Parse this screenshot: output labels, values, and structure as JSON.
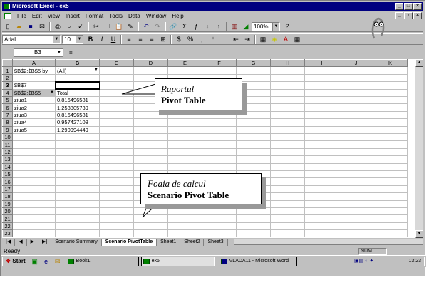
{
  "window": {
    "title": "Microsoft Excel - ex5",
    "minimize_icon": "minimize-icon",
    "maximize_icon": "maximize-icon",
    "close_icon": "close-icon"
  },
  "menubar": {
    "items": [
      "File",
      "Edit",
      "View",
      "Insert",
      "Format",
      "Tools",
      "Data",
      "Window",
      "Help"
    ]
  },
  "toolbar1": {
    "zoom": "100%"
  },
  "toolbar2": {
    "font_name": "Arial",
    "font_size": "10",
    "bold": "B",
    "italic": "I",
    "underline": "U",
    "percent": "%",
    "comma": ","
  },
  "formula_bar": {
    "name_box": "B3",
    "equals": "="
  },
  "grid": {
    "columns": [
      "A",
      "B",
      "C",
      "D",
      "E",
      "F",
      "G",
      "H",
      "I",
      "J",
      "K"
    ],
    "rows": [
      {
        "n": "1",
        "a": "$B$2:$B$5 by",
        "b": "(All)"
      },
      {
        "n": "2",
        "a": "",
        "b": ""
      },
      {
        "n": "3",
        "a": "$B$7",
        "b": ""
      },
      {
        "n": "4",
        "a": "$B$2:$B$5",
        "b": "Total"
      },
      {
        "n": "5",
        "a": "ziua1",
        "b": "0,816496581"
      },
      {
        "n": "6",
        "a": "ziua2",
        "b": "1,258305739"
      },
      {
        "n": "7",
        "a": "ziua3",
        "b": "0,816496581"
      },
      {
        "n": "8",
        "a": "ziua4",
        "b": "0,957427108"
      },
      {
        "n": "9",
        "a": "ziua5",
        "b": "1,290994449"
      },
      {
        "n": "10",
        "a": "",
        "b": ""
      },
      {
        "n": "11",
        "a": "",
        "b": ""
      },
      {
        "n": "12",
        "a": "",
        "b": ""
      },
      {
        "n": "13",
        "a": "",
        "b": ""
      },
      {
        "n": "14",
        "a": "",
        "b": ""
      },
      {
        "n": "15",
        "a": "",
        "b": ""
      },
      {
        "n": "16",
        "a": "",
        "b": ""
      },
      {
        "n": "17",
        "a": "",
        "b": ""
      },
      {
        "n": "18",
        "a": "",
        "b": ""
      },
      {
        "n": "19",
        "a": "",
        "b": ""
      },
      {
        "n": "20",
        "a": "",
        "b": ""
      },
      {
        "n": "21",
        "a": "",
        "b": ""
      },
      {
        "n": "22",
        "a": "",
        "b": ""
      },
      {
        "n": "23",
        "a": "",
        "b": ""
      }
    ]
  },
  "callouts": {
    "pivot_line1": "Raportul",
    "pivot_line2": "Pivot Table",
    "sheet_line1": "Foaia de calcul",
    "sheet_line2": "Scenario Pivot Table"
  },
  "sheet_tabs": {
    "items": [
      "Scenario Summary",
      "Scenario PivotTable",
      "Sheet1",
      "Sheet2",
      "Sheet3"
    ],
    "active": "Scenario PivotTable"
  },
  "status": {
    "text": "Ready",
    "num": "NUM"
  },
  "taskbar": {
    "start": "Start",
    "tasks": [
      "Book1",
      "ex5",
      "VLADA11 - Microsoft Word"
    ],
    "clock": "13:23"
  }
}
